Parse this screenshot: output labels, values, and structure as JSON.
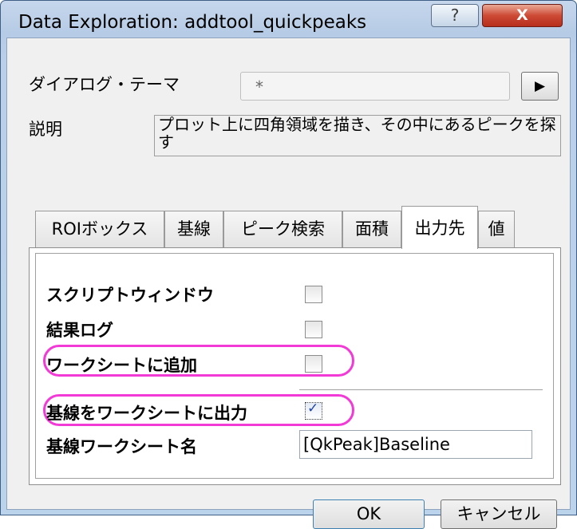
{
  "window": {
    "title": "Data Exploration: addtool_quickpeaks",
    "help_label": "?",
    "close_label": "X"
  },
  "theme": {
    "label": "ダイアログ・テーマ",
    "value": "*",
    "arrow": "▶"
  },
  "description": {
    "label": "説明",
    "text": "プロット上に四角領域を描き、その中にあるピークを探す"
  },
  "tabs": [
    {
      "label": "ROIボックス"
    },
    {
      "label": "基線"
    },
    {
      "label": "ピーク検索"
    },
    {
      "label": "面積"
    },
    {
      "label": "出力先",
      "active": true
    },
    {
      "label": "値"
    }
  ],
  "output": {
    "options": [
      {
        "label": "スクリプトウィンドウ",
        "checked": false
      },
      {
        "label": "結果ログ",
        "checked": false
      },
      {
        "label": "ワークシートに追加",
        "checked": false
      },
      {
        "label": "基線をワークシートに出力",
        "checked": true
      }
    ],
    "checkmark": "✓",
    "sheet_name_label": "基線ワークシート名",
    "sheet_name_value": "[QkPeak]Baseline"
  },
  "buttons": {
    "ok": "OK",
    "cancel": "キャンセル"
  },
  "colors": {
    "highlight": "#f23ad6",
    "close_red": "#cd4a35",
    "frame_blue": "#bcd3ec"
  }
}
